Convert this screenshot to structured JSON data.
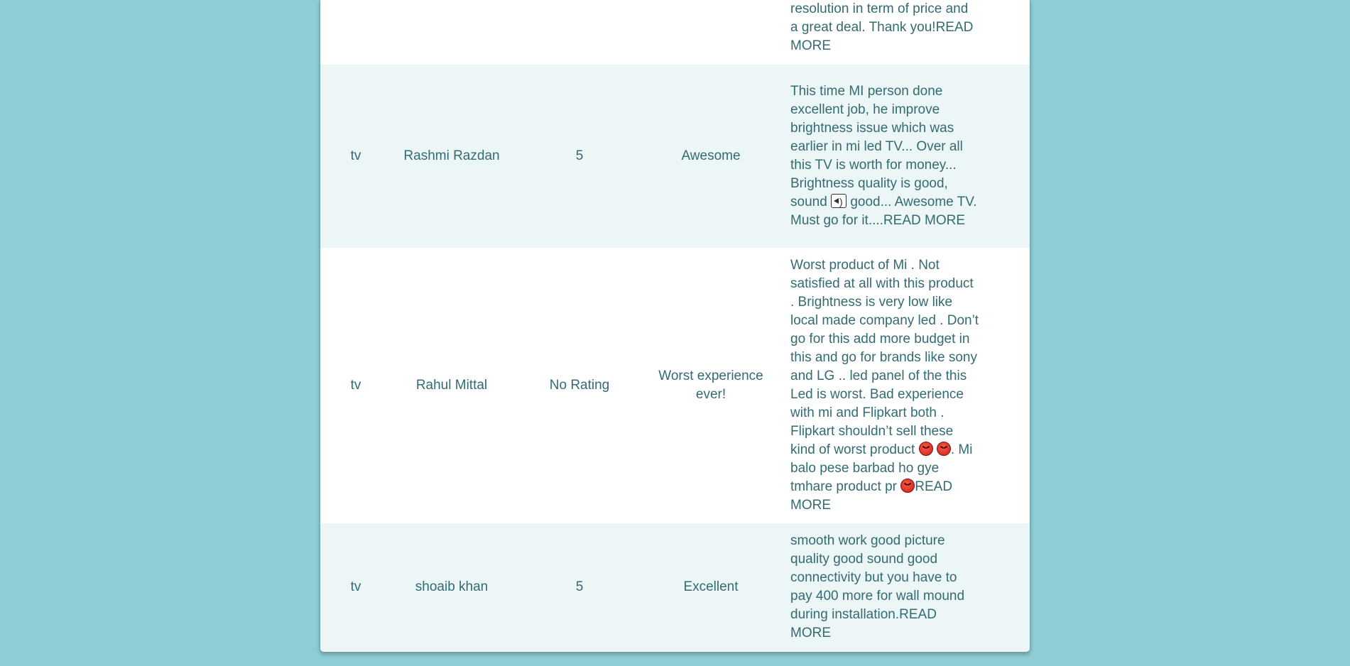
{
  "reviews": [
    {
      "product": "",
      "name": "",
      "rating": "",
      "title": "",
      "comment_parts": [
        "resolution in term of price and a great deal. Thank you!READ MORE"
      ]
    },
    {
      "product": "tv",
      "name": "Rashmi Razdan",
      "rating": "5",
      "title": "Awesome",
      "comment_parts": [
        "This time MI person done excellent job, he improve brightness issue which was earlier in mi led TV... Over all this TV is worth for money... Brightness quality is good, sound ",
        " good... Awesome TV. Must go for it....READ MORE"
      ]
    },
    {
      "product": "tv",
      "name": "Rahul Mittal",
      "rating": "No Rating",
      "title": "Worst experience ever!",
      "comment_parts": [
        "Worst product of Mi . Not satisfied at all with this product . Brightness is very low like local made company led . Don’t go for this add more budget in this and go for brands like sony and LG .. led panel of the this Led is worst. Bad experience with mi and Flipkart both . Flipkart shouldn’t sell these kind of worst product ",
        ". Mi balo pese barbad ho gye tmhare product pr ",
        "READ MORE"
      ]
    },
    {
      "product": "tv",
      "name": "shoaib khan",
      "rating": "5",
      "title": "Excellent",
      "comment_parts": [
        "smooth work good picture quality good sound good connectivity but you have to pay 400 more for wall mound during installation.READ MORE"
      ]
    }
  ],
  "icons": {
    "speaker": "speaker-emoji",
    "angry": "angry-face-emoji"
  },
  "colors": {
    "page_background": "#8fcdd5",
    "row_alt": "#ecf6f7",
    "text": "#336b72"
  }
}
